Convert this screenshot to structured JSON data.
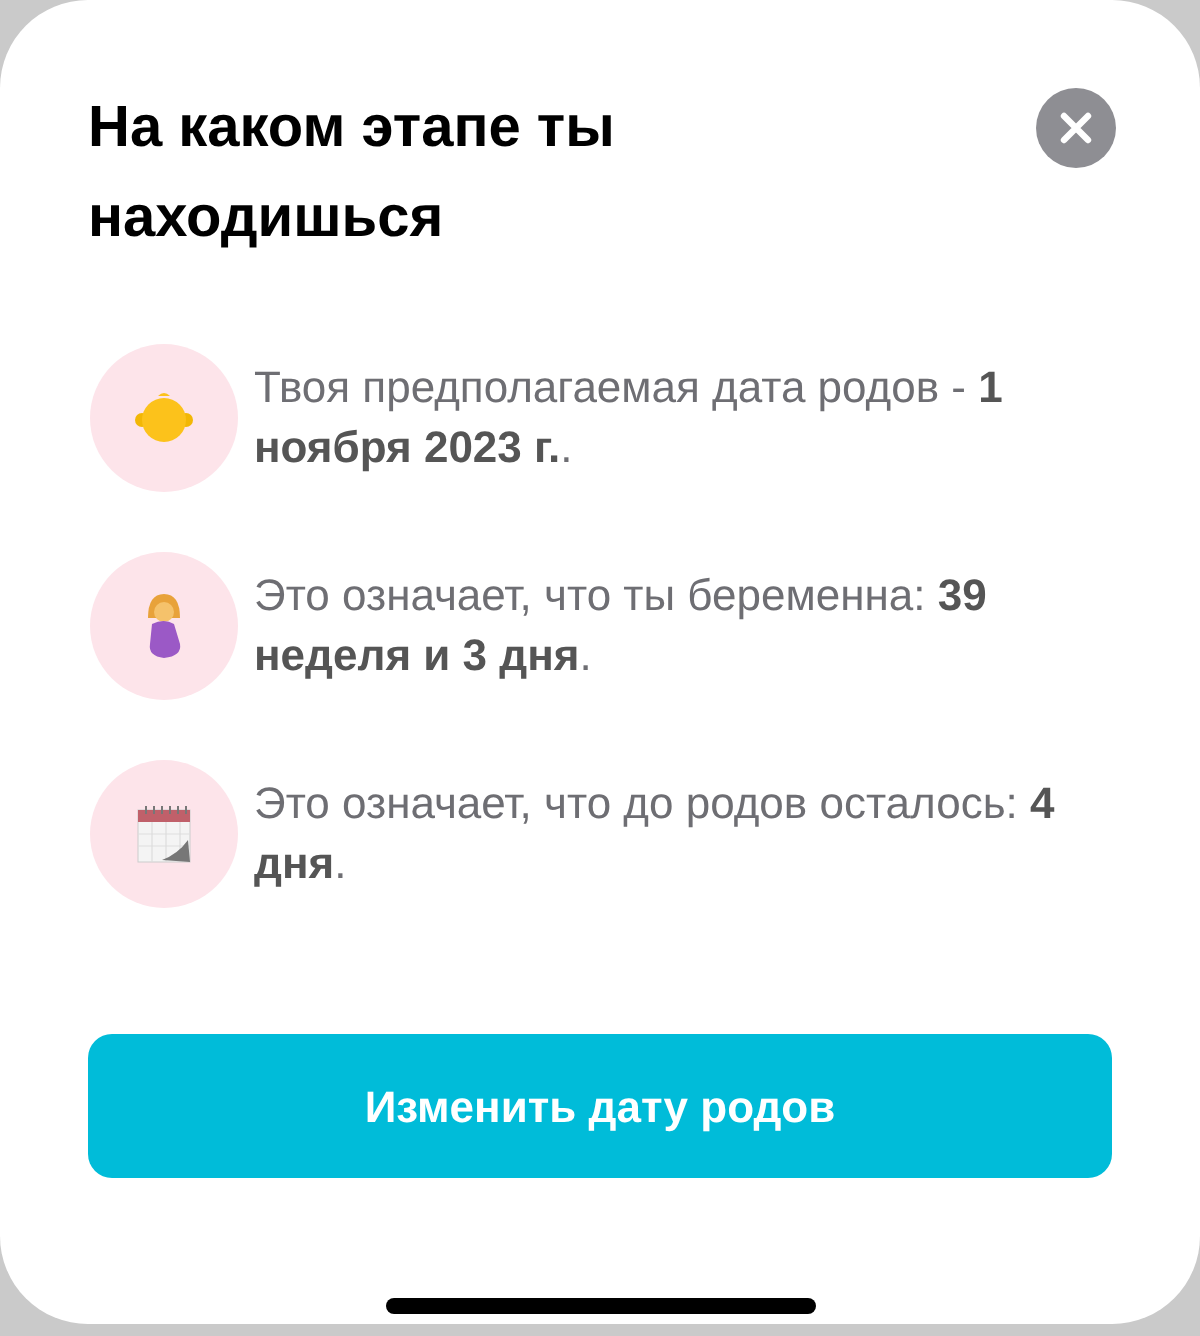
{
  "sheet": {
    "title": "На каком этапе ты находишься"
  },
  "items": [
    {
      "kind": "baby",
      "text": "Твоя предполагаемая дата родов - **1 ноября 2023 г.**."
    },
    {
      "kind": "pregnant",
      "text": "Это означает, что ты беременна: **39 неделя и 3 дня**."
    },
    {
      "kind": "calendar",
      "text": "Это означает, что до родов осталось: **4 дня**."
    }
  ],
  "button": {
    "label": "Изменить дату родов"
  }
}
